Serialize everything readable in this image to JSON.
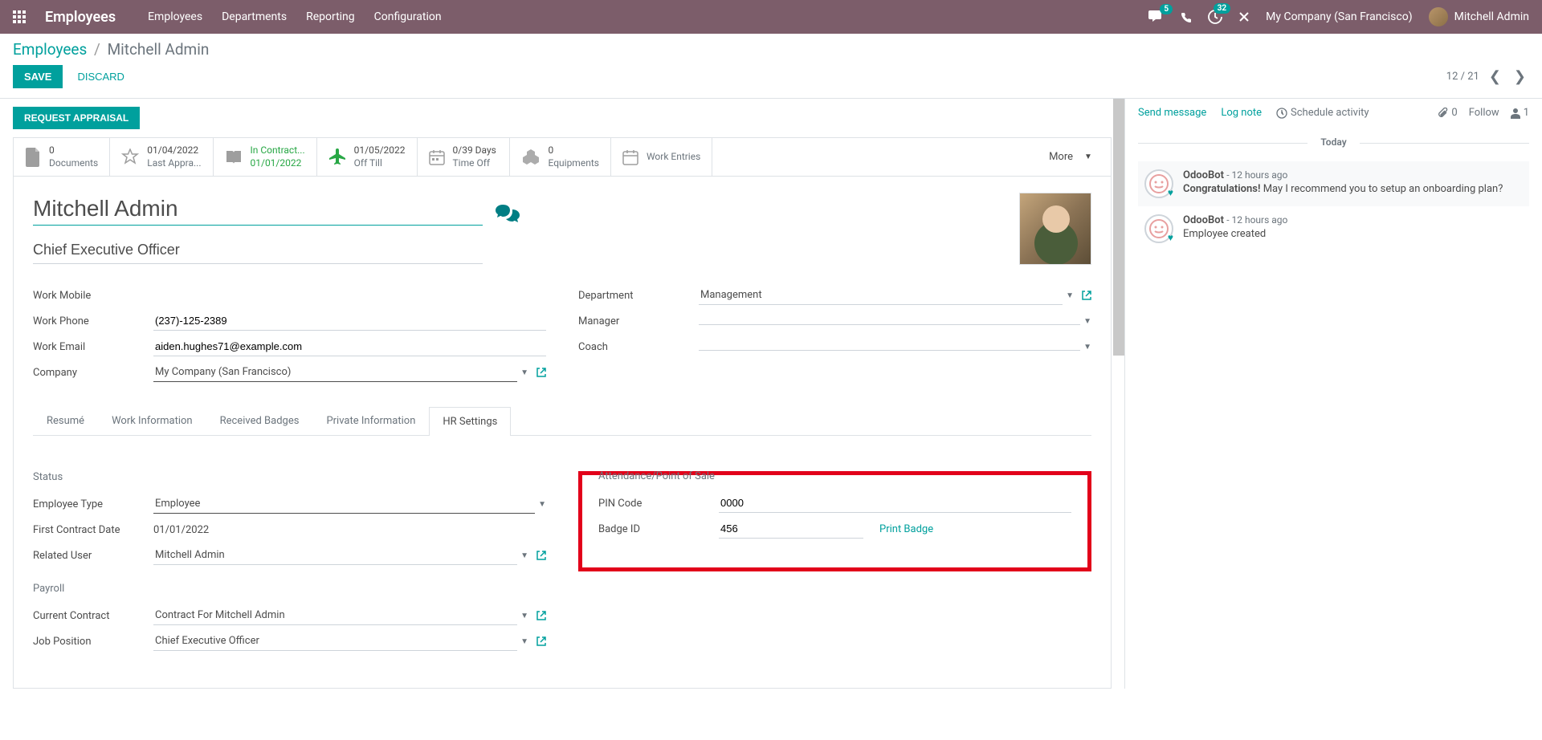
{
  "nav": {
    "app_title": "Employees",
    "menu": [
      "Employees",
      "Departments",
      "Reporting",
      "Configuration"
    ],
    "chat_badge": "5",
    "clock_badge": "32",
    "company": "My Company (San Francisco)",
    "user": "Mitchell Admin"
  },
  "breadcrumb": {
    "root": "Employees",
    "current": "Mitchell Admin"
  },
  "actions": {
    "save": "SAVE",
    "discard": "DISCARD",
    "pager": "12 / 21",
    "request_appraisal": "REQUEST APPRAISAL"
  },
  "stats": [
    {
      "icon": "document",
      "v1": "0",
      "v2": "Documents"
    },
    {
      "icon": "star",
      "v1": "01/04/2022",
      "v2": "Last Appra..."
    },
    {
      "icon": "book",
      "v1": "In Contract...",
      "v2": "01/01/2022",
      "green": true
    },
    {
      "icon": "plane",
      "v1": "01/05/2022",
      "v2": "Off Till"
    },
    {
      "icon": "calendar",
      "v1": "0/39 Days",
      "v2": "Time Off"
    },
    {
      "icon": "cubes",
      "v1": "0",
      "v2": "Equipments"
    },
    {
      "icon": "calendar2",
      "v1": "",
      "v2": "Work Entries"
    }
  ],
  "stats_more": "More",
  "employee": {
    "name": "Mitchell Admin",
    "job_title": "Chief Executive Officer"
  },
  "fields_left": {
    "work_mobile": {
      "label": "Work Mobile",
      "value": ""
    },
    "work_phone": {
      "label": "Work Phone",
      "value": "(237)-125-2389"
    },
    "work_email": {
      "label": "Work Email",
      "value": "aiden.hughes71@example.com"
    },
    "company": {
      "label": "Company",
      "value": "My Company (San Francisco)"
    }
  },
  "fields_right": {
    "department": {
      "label": "Department",
      "value": "Management"
    },
    "manager": {
      "label": "Manager",
      "value": ""
    },
    "coach": {
      "label": "Coach",
      "value": ""
    }
  },
  "tabs": [
    "Resumé",
    "Work Information",
    "Received Badges",
    "Private Information",
    "HR Settings"
  ],
  "hr": {
    "status_heading": "Status",
    "employee_type": {
      "label": "Employee Type",
      "value": "Employee"
    },
    "first_contract": {
      "label": "First Contract Date",
      "value": "01/01/2022"
    },
    "related_user": {
      "label": "Related User",
      "value": "Mitchell Admin"
    },
    "attendance_heading": "Attendance/Point of Sale",
    "pin": {
      "label": "PIN Code",
      "value": "0000"
    },
    "badge": {
      "label": "Badge ID",
      "value": "456",
      "print": "Print Badge"
    },
    "payroll_heading": "Payroll",
    "contract": {
      "label": "Current Contract",
      "value": "Contract For Mitchell Admin"
    },
    "job_pos": {
      "label": "Job Position",
      "value": "Chief Executive Officer"
    }
  },
  "sidebar": {
    "send": "Send message",
    "log": "Log note",
    "schedule": "Schedule activity",
    "attach_count": "0",
    "follow": "Follow",
    "follower_count": "1",
    "today": "Today",
    "messages": [
      {
        "author": "OdooBot",
        "time": "- 12 hours ago",
        "strong": "Congratulations!",
        "rest": " May I recommend you to setup an onboarding plan?"
      },
      {
        "author": "OdooBot",
        "time": "- 12 hours ago",
        "strong": "",
        "rest": "Employee created"
      }
    ]
  }
}
